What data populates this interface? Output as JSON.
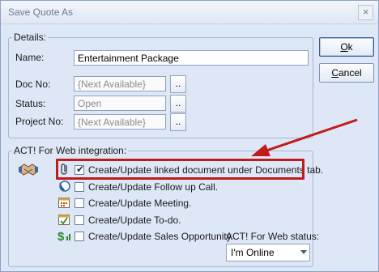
{
  "window": {
    "title": "Save Quote As",
    "close_label": "×"
  },
  "details": {
    "legend": "Details:",
    "name_label": "Name:",
    "name_value": "Entertainment Package",
    "docno_label": "Doc No:",
    "docno_value": "{Next Available}",
    "status_label": "Status:",
    "status_value": "Open",
    "projectno_label": "Project No:",
    "projectno_value": "{Next Available}",
    "browse_label": ".."
  },
  "buttons": {
    "ok_label": "Ok",
    "cancel_label": "Cancel"
  },
  "integration": {
    "legend": "ACT! For Web integration:",
    "options": [
      {
        "label": "Create/Update linked document under Documents tab.",
        "checked": true,
        "icon": "paperclip-icon"
      },
      {
        "label": "Create/Update Follow up Call.",
        "checked": false,
        "icon": "phone-icon"
      },
      {
        "label": "Create/Update Meeting.",
        "checked": false,
        "icon": "calendar-icon"
      },
      {
        "label": "Create/Update To-do.",
        "checked": false,
        "icon": "todo-icon"
      },
      {
        "label": "Create/Update Sales Opportunity.",
        "checked": false,
        "icon": "dollar-icon"
      }
    ],
    "status_label": "ACT! For Web status:",
    "status_value": "I'm Online"
  },
  "colors": {
    "highlight": "#c01c1c",
    "window_bg": "#dde7f5"
  }
}
